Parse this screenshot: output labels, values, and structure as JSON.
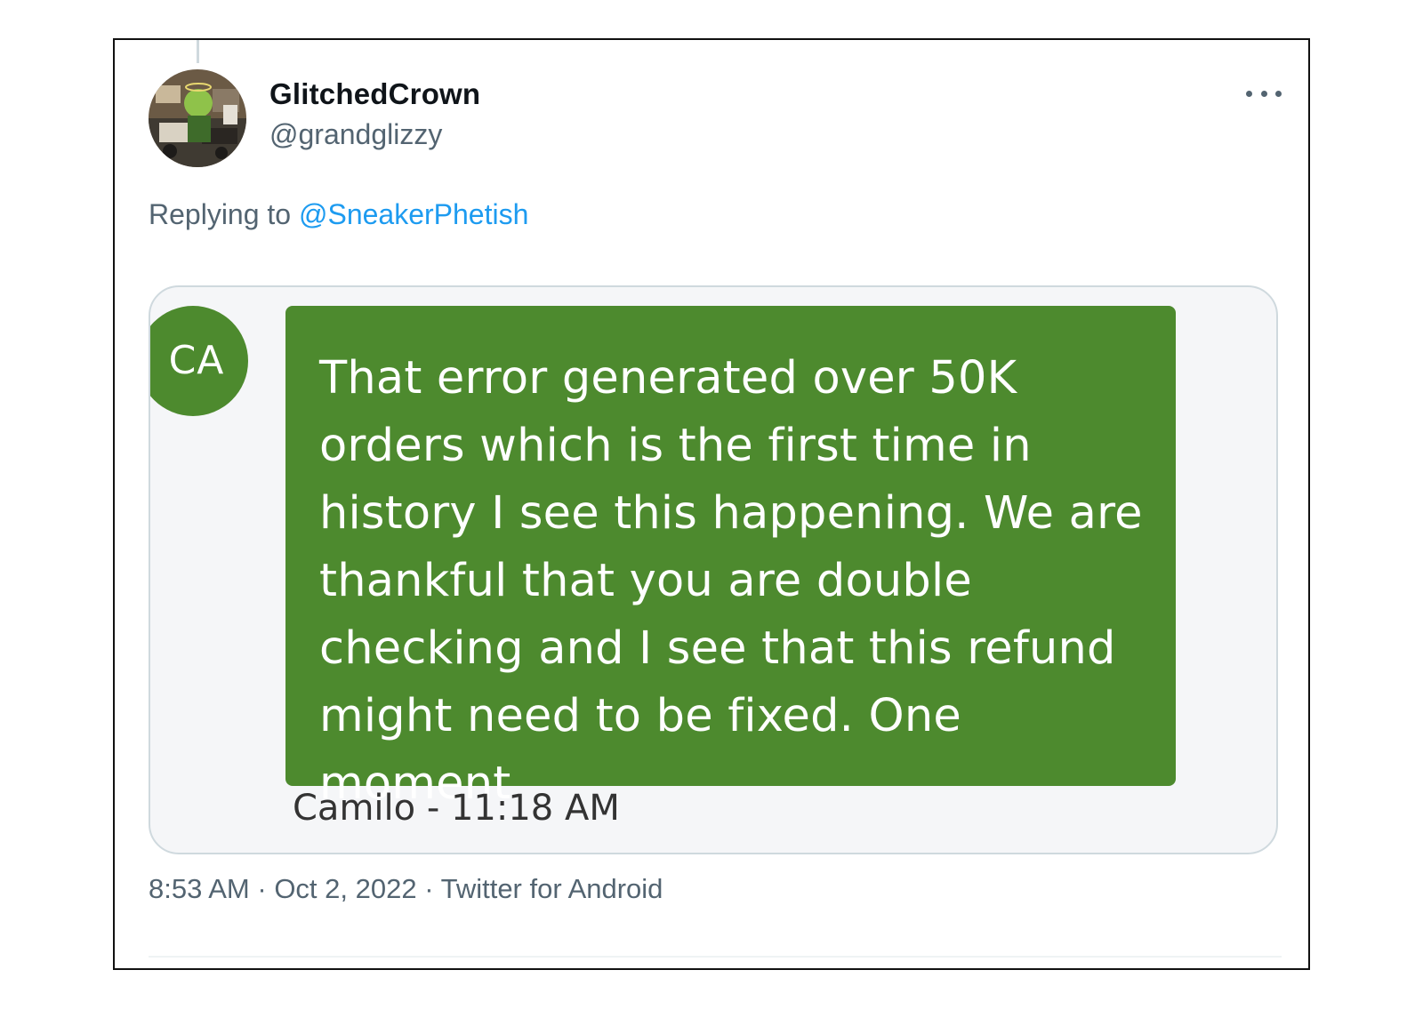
{
  "tweet": {
    "display_name": "GlitchedCrown",
    "handle": "@grandglizzy",
    "replying_prefix": "Replying to ",
    "replying_mention": "@SneakerPhetish",
    "timestamp": "8:53 AM",
    "separator": " · ",
    "date": "Oct 2, 2022",
    "source": "Twitter for Android",
    "more_icon": "more-horizontal-icon"
  },
  "chat_screenshot": {
    "avatar_initials": "CA",
    "message": "That error generated over 50K orders which is the first time in history I see this happening. We are thankful that you are double checking and I see that this refund might need to be fixed. One moment",
    "sender_time": "Camilo - 11:18 AM",
    "bubble_color": "#4d8a2e"
  },
  "colors": {
    "link": "#1d9bf0",
    "secondary_text": "#536471",
    "primary_text": "#0f1419"
  }
}
